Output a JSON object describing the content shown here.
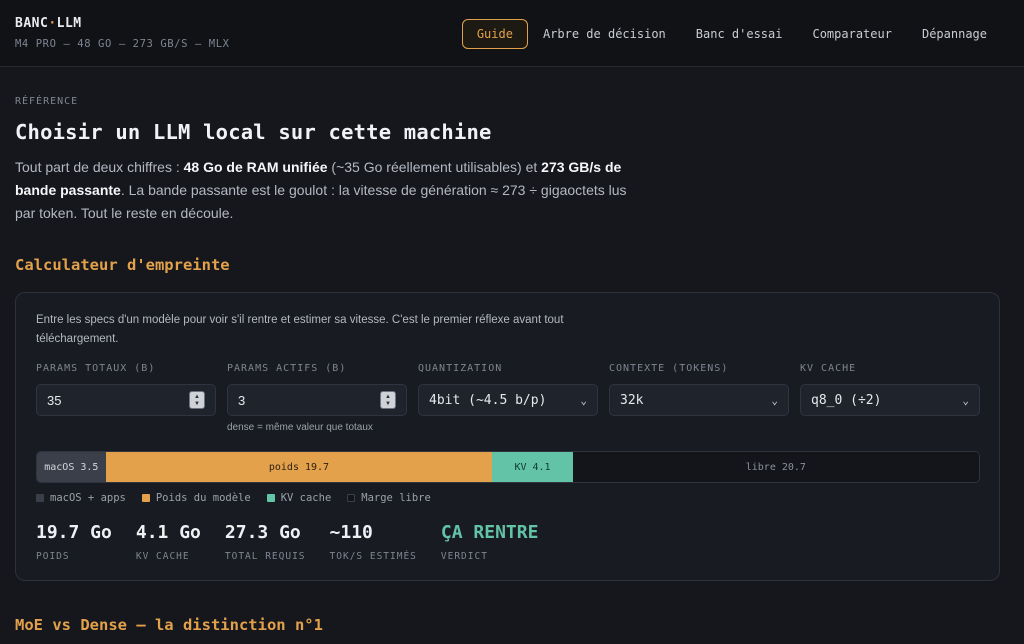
{
  "brand": {
    "title_a": "BANC",
    "title_dot": "·",
    "title_b": "LLM",
    "subtitle": "M4 PRO — 48 GO — 273 GB/S — MLX"
  },
  "nav": [
    {
      "label": "Guide",
      "active": true
    },
    {
      "label": "Arbre de décision",
      "active": false
    },
    {
      "label": "Banc d'essai",
      "active": false
    },
    {
      "label": "Comparateur",
      "active": false
    },
    {
      "label": "Dépannage",
      "active": false
    }
  ],
  "page": {
    "eyebrow": "RÉFÉRENCE",
    "title": "Choisir un LLM local sur cette machine",
    "intro": {
      "p1": "Tout part de deux chiffres : ",
      "b1": "48 Go de RAM unifiée",
      "p2": " (~35 Go réellement utilisables) et ",
      "b2": "273 GB/s de bande passante",
      "p3": ". La bande passante est le goulot : la vitesse de génération ≈ 273 ÷ gigaoctets lus par token. Tout le reste en découle."
    }
  },
  "calculator": {
    "heading": "Calculateur d'empreinte",
    "description": "Entre les specs d'un modèle pour voir s'il rentre et estimer sa vitesse. C'est le premier réflexe avant tout téléchargement.",
    "fields": {
      "params_total": {
        "label": "PARAMS TOTAUX (B)",
        "value": "35"
      },
      "params_active": {
        "label": "PARAMS ACTIFS (B)",
        "value": "3",
        "hint": "dense = même valeur que totaux"
      },
      "quantization": {
        "label": "QUANTIZATION",
        "value": "4bit (~4.5 b/p)"
      },
      "context": {
        "label": "CONTEXTE (TOKENS)",
        "value": "32k"
      },
      "kv_cache": {
        "label": "KV CACHE",
        "value": "q8_0 (÷2)"
      }
    },
    "memory_bar": {
      "total_gb": 48,
      "segments": [
        {
          "key": "os",
          "label": "macOS 3.5",
          "gb": 3.5,
          "color": "#3a3f4a"
        },
        {
          "key": "weights",
          "label": "poids 19.7",
          "gb": 19.7,
          "color": "#e2a14a"
        },
        {
          "key": "kv",
          "label": "KV 4.1",
          "gb": 4.1,
          "color": "#63c3a6"
        },
        {
          "key": "free",
          "label": "libre 20.7",
          "gb": 20.7,
          "color": "#13151a"
        }
      ]
    },
    "legend": [
      {
        "label": "macOS + apps",
        "color": "#3a3f4a"
      },
      {
        "label": "Poids du modèle",
        "color": "#e2a14a"
      },
      {
        "label": "KV cache",
        "color": "#63c3a6"
      },
      {
        "label": "Marge libre",
        "color": "#13151a"
      }
    ],
    "stats": {
      "weights": {
        "value": "19.7 Go",
        "label": "POIDS"
      },
      "kv": {
        "value": "4.1 Go",
        "label": "KV CACHE"
      },
      "total": {
        "value": "27.3 Go",
        "label": "TOTAL REQUIS"
      },
      "speed": {
        "value": "~110",
        "label": "TOK/S ESTIMÉS"
      },
      "verdict": {
        "value": "ÇA RENTRE",
        "label": "VERDICT"
      }
    }
  },
  "next_section": {
    "heading": "MoE vs Dense — la distinction n°1"
  },
  "icons": {
    "spinner": "number-spinner-icon",
    "dropdown": "chevron-down-icon"
  },
  "colors": {
    "accent": "#e2a14a",
    "success": "#63c3a6",
    "background": "#15171d"
  }
}
